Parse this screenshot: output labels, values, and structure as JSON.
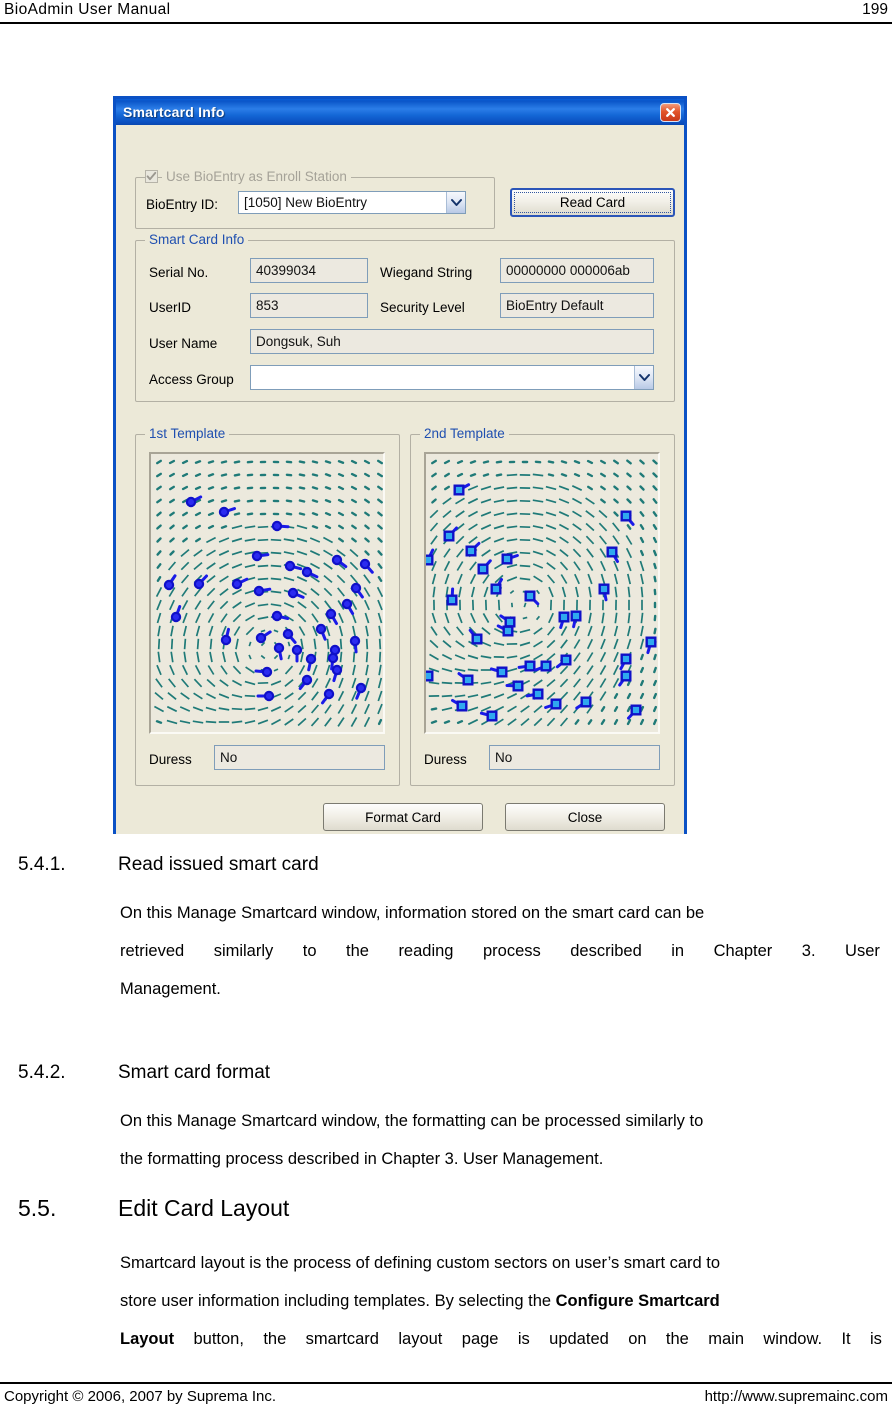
{
  "page": {
    "header_title": "BioAdmin  User  Manual",
    "page_number": "199",
    "footer_left": "Copyright © 2006, 2007 by Suprema Inc.",
    "footer_right": "http://www.supremainc.com"
  },
  "dialog": {
    "title": "Smartcard Info",
    "close_icon": "close-icon",
    "enroll_group": {
      "legend": "Use BioEntry as Enroll Station",
      "checkbox_checked": true,
      "bioentry_id_label": "BioEntry ID:",
      "bioentry_id_value": "[1050] New BioEntry",
      "read_card_label": "Read Card"
    },
    "smart_card_info": {
      "legend": "Smart Card Info",
      "serial_no_label": "Serial No.",
      "serial_no_value": "40399034",
      "wiegand_label": "Wiegand String",
      "wiegand_value": "00000000 000006ab",
      "userid_label": "UserID",
      "userid_value": "853",
      "security_level_label": "Security Level",
      "security_level_value": "BioEntry Default",
      "user_name_label": "User Name",
      "user_name_value": "Dongsuk, Suh",
      "access_group_label": "Access Group",
      "access_group_value": ""
    },
    "template1": {
      "legend": "1st Template",
      "duress_label": "Duress",
      "duress_value": "No"
    },
    "template2": {
      "legend": "2nd Template",
      "duress_label": "Duress",
      "duress_value": "No"
    },
    "buttons": {
      "format_card": "Format Card",
      "close": "Close"
    },
    "colors": {
      "titlebar_blue": "#0b5ed7",
      "window_frame": "#0b51c5",
      "dialog_face": "#ece9d8",
      "legend_blue": "#1f4fb0",
      "ridge_teal": "#1f7a78",
      "minutia_blue": "#1a1ae8",
      "close_red": "#c8381a"
    }
  },
  "content": {
    "sections": [
      {
        "number": "5.4.1.",
        "heading": "Read issued smart card",
        "level": "h3",
        "paragraphs": [
          "On this Manage Smartcard window, information stored on the smart card can be retrieved similarly to the reading process described in Chapter 3. User Management."
        ]
      },
      {
        "number": "5.4.2.",
        "heading": "Smart card format",
        "level": "h3",
        "paragraphs": [
          "On this Manage Smartcard window, the formatting can be processed similarly to the formatting process described in Chapter 3. User Management."
        ]
      },
      {
        "number": "5.5.",
        "heading": "Edit Card Layout",
        "level": "h2",
        "paragraphs": [
          "Smartcard layout is the process of defining custom sectors on user’s smart card to store user information including templates. By selecting the Configure Smartcard Layout button, the smartcard layout page is updated on the main window. It is"
        ],
        "bold_run": "Configure Smartcard Layout"
      }
    ],
    "body_lines": {
      "s1_l1": "On this Manage Smartcard window, information stored on the smart card can be",
      "s1_l2_words": [
        "retrieved",
        "similarly",
        "to",
        "the",
        "reading",
        "process",
        "described",
        "in",
        "Chapter",
        "3.",
        "User"
      ],
      "s1_l3": "Management.",
      "s2_l1": "On this Manage Smartcard window, the formatting can be processed similarly to",
      "s2_l2": "the formatting process described in Chapter 3. User Management.",
      "s3_l1": "Smartcard layout is the process of defining custom sectors on user’s smart card to",
      "s3_l2_a": "store user information including templates. By selecting the ",
      "s3_l2_b": "Configure Smartcard",
      "s3_l3_b": "Layout",
      "s3_l3_words": [
        "button,",
        "the",
        "smartcard",
        "layout",
        "page",
        "is",
        "updated",
        "on",
        "the",
        "main",
        "window.",
        "It",
        "is"
      ]
    }
  }
}
